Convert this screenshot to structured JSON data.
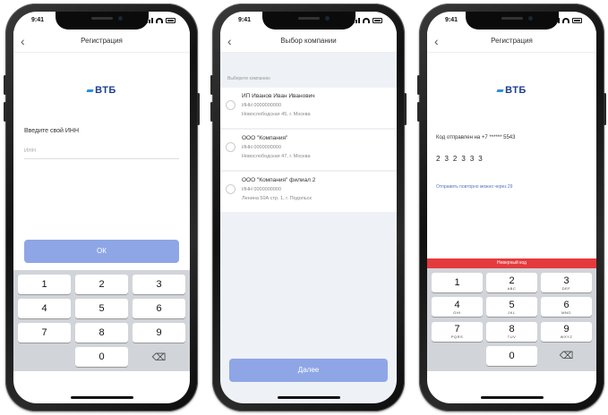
{
  "status": {
    "time": "9:41"
  },
  "screen1": {
    "title": "Регистрация",
    "logo": "ВТБ",
    "label": "Введите свой ИНН",
    "placeholder": "ИНН",
    "button": "ОК",
    "keys": [
      "1",
      "2",
      "3",
      "4",
      "5",
      "6",
      "7",
      "8",
      "9",
      "0"
    ]
  },
  "screen2": {
    "title": "Выбор компании",
    "section": "Выберите компанию",
    "companies": [
      {
        "name": "ИП Иванов Иван Иванович",
        "inn": "ИНН 0000000000",
        "address": "Новослободская 45, г. Москва"
      },
      {
        "name": "ООО \"Компания\"",
        "inn": "ИНН 0000000000",
        "address": "Новослободская 47, г. Москва"
      },
      {
        "name": "ООО \"Компания\" филиал 2",
        "inn": "ИНН 0000000000",
        "address": "Ленина 50А стр. 1, г. Подольск"
      }
    ],
    "button": "Далее"
  },
  "screen3": {
    "title": "Регистрация",
    "logo": "ВТБ",
    "sms_text": "Код отправлен на +7 ****** 5543",
    "code": [
      "2",
      "3",
      "2",
      "3",
      "3",
      "3"
    ],
    "resend": "Отправить повторно можно через 29",
    "error": "Неверный код",
    "keys": [
      {
        "d": "1",
        "s": ""
      },
      {
        "d": "2",
        "s": "ABC"
      },
      {
        "d": "3",
        "s": "DEF"
      },
      {
        "d": "4",
        "s": "GHI"
      },
      {
        "d": "5",
        "s": "JKL"
      },
      {
        "d": "6",
        "s": "MNO"
      },
      {
        "d": "7",
        "s": "PQRS"
      },
      {
        "d": "8",
        "s": "TUV"
      },
      {
        "d": "9",
        "s": "WXYZ"
      },
      {
        "d": "0",
        "s": ""
      }
    ]
  },
  "icons": {
    "back": "chevron-left-icon",
    "delete": "backspace-icon"
  },
  "colors": {
    "accent": "#8ea6e6",
    "error": "#e53a3d",
    "logo": "#1d3d8f",
    "logo_dash": "#2f8fd8"
  }
}
